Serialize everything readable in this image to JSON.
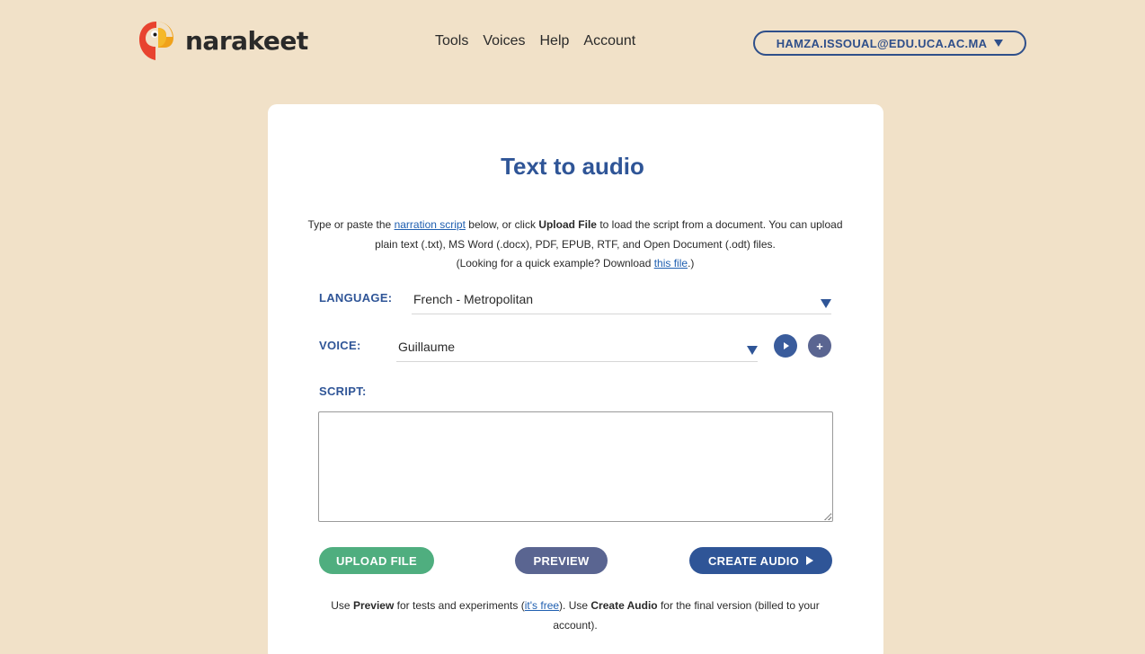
{
  "brand": {
    "name": "narakeet"
  },
  "nav": [
    {
      "label": "Tools"
    },
    {
      "label": "Voices"
    },
    {
      "label": "Help"
    },
    {
      "label": "Account"
    }
  ],
  "account": {
    "email": "HAMZA.ISSOUAL@EDU.UCA.AC.MA"
  },
  "page": {
    "title": "Text to audio"
  },
  "intro": {
    "p1": "Type or paste the ",
    "link1": "narration script",
    "p2": " below, or click ",
    "bold1": "Upload File",
    "p3": " to load the script from a document. You can upload plain text (.txt), MS Word (.docx), PDF, EPUB, RTF, and Open Document (.odt) files.",
    "p4": "(Looking for a quick example? Download ",
    "link2": "this file",
    "p5": ".)"
  },
  "form": {
    "language_label": "LANGUAGE:",
    "language_value": "French - Metropolitan",
    "voice_label": "VOICE:",
    "voice_value": "Guillaume",
    "script_label": "SCRIPT:",
    "script_value": ""
  },
  "buttons": {
    "upload": "UPLOAD FILE",
    "preview": "PREVIEW",
    "create": "CREATE AUDIO"
  },
  "footnote": {
    "p1": "Use ",
    "b1": "Preview",
    "p2": " for tests and experiments (",
    "link": "it's free",
    "p3": "). Use ",
    "b2": "Create Audio",
    "p4": " for the final version (billed to your account)."
  },
  "colors": {
    "background": "#f1e1c8",
    "brand_blue": "#2f5597",
    "upload_green": "#4fae7f",
    "preview_slate": "#5a6591",
    "create_blue": "#2f5597",
    "play_circle": "#3a5c9c",
    "add_circle": "#5a6591"
  },
  "icons": {
    "logo": "parrot-logo-icon",
    "account_caret": "caret-down-icon",
    "language_caret": "caret-down-icon",
    "voice_caret": "caret-down-icon",
    "voice_play": "play-icon",
    "voice_add": "plus-icon",
    "create_play": "play-icon"
  }
}
